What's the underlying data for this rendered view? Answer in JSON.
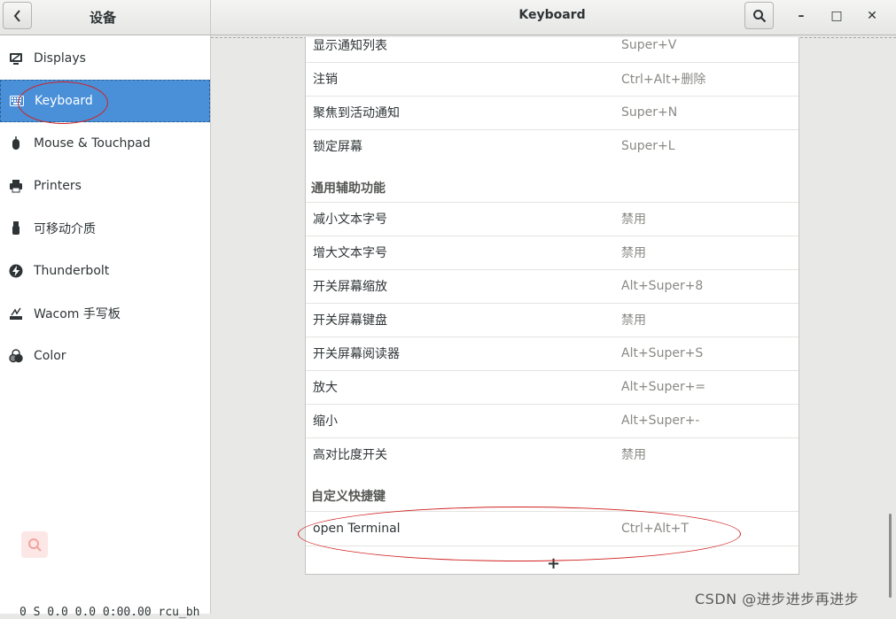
{
  "header": {
    "panel_title": "设备",
    "window_title": "Keyboard",
    "back_icon": "chevron-left-icon",
    "search_icon": "search-icon",
    "min_glyph": "–",
    "max_glyph": "□",
    "close_glyph": "✕"
  },
  "sidebar": {
    "items": [
      {
        "label": "Displays",
        "icon": "display-icon"
      },
      {
        "label": "Keyboard",
        "icon": "keyboard-icon",
        "active": true
      },
      {
        "label": "Mouse & Touchpad",
        "icon": "mouse-icon"
      },
      {
        "label": "Printers",
        "icon": "printer-icon"
      },
      {
        "label": "可移动介质",
        "icon": "usb-drive-icon"
      },
      {
        "label": "Thunderbolt",
        "icon": "thunderbolt-icon"
      },
      {
        "label": "Wacom 手写板",
        "icon": "tablet-icon"
      },
      {
        "label": "Color",
        "icon": "color-icon"
      }
    ],
    "active_color": "#4a90d9"
  },
  "shortcuts": {
    "system_rows": [
      {
        "name": "显示通知列表",
        "accel": "Super+V"
      },
      {
        "name": "注销",
        "accel": "Ctrl+Alt+删除"
      },
      {
        "name": "聚焦到活动通知",
        "accel": "Super+N"
      },
      {
        "name": "锁定屏幕",
        "accel": "Super+L"
      }
    ],
    "universal_access_heading": "通用辅助功能",
    "universal_access_rows": [
      {
        "name": "减小文本字号",
        "accel": "禁用"
      },
      {
        "name": "增大文本字号",
        "accel": "禁用"
      },
      {
        "name": "开关屏幕缩放",
        "accel": "Alt+Super+8"
      },
      {
        "name": "开关屏幕键盘",
        "accel": "禁用"
      },
      {
        "name": "开关屏幕阅读器",
        "accel": "Alt+Super+S"
      },
      {
        "name": "放大",
        "accel": "Alt+Super+="
      },
      {
        "name": "缩小",
        "accel": "Alt+Super+-"
      },
      {
        "name": "高对比度开关",
        "accel": "禁用"
      }
    ],
    "custom_heading": "自定义快捷键",
    "custom_rows": [
      {
        "name": "open Terminal",
        "accel": "Ctrl+Alt+T"
      }
    ],
    "add_glyph": "+"
  },
  "watermark": "CSDN @进步进步再进步",
  "terminal_strip": "0 S   0.0  0.0   0:00.00 rcu_bh"
}
